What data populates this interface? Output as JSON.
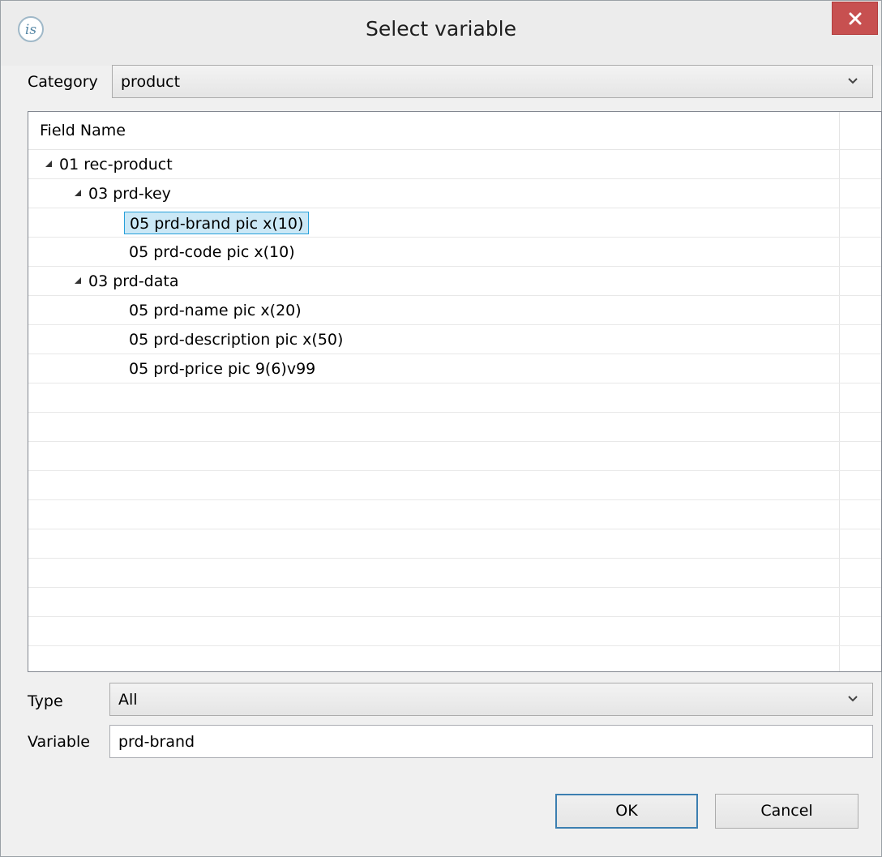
{
  "window": {
    "title": "Select variable"
  },
  "category": {
    "label": "Category",
    "value": "product"
  },
  "tree": {
    "column_header": "Field Name",
    "rows": [
      {
        "text": "01 rec-product",
        "level": 0,
        "expanded": true
      },
      {
        "text": "03 prd-key",
        "level": 1,
        "expanded": true
      },
      {
        "text": "05 prd-brand pic x(10)",
        "level": 2,
        "selected": true
      },
      {
        "text": "05 prd-code pic x(10)",
        "level": 2
      },
      {
        "text": "03 prd-data",
        "level": 1,
        "expanded": true
      },
      {
        "text": "05 prd-name pic x(20)",
        "level": 2
      },
      {
        "text": "05 prd-description pic x(50)",
        "level": 2
      },
      {
        "text": "05 prd-price pic 9(6)v99",
        "level": 2
      }
    ]
  },
  "type": {
    "label": "Type",
    "value": "All"
  },
  "variable": {
    "label": "Variable",
    "value": "prd-brand"
  },
  "buttons": {
    "ok": "OK",
    "cancel": "Cancel"
  },
  "colors": {
    "close": "#c75050",
    "selection": "#cbe8f6",
    "selection_border": "#26a0da"
  }
}
